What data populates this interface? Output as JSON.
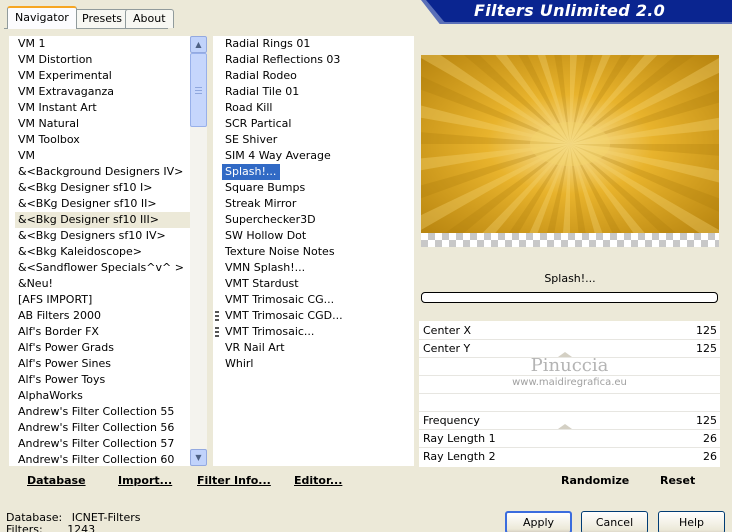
{
  "window": {
    "title": "Filters Unlimited 2.0"
  },
  "tabs": [
    {
      "label": "Navigator",
      "active": true
    },
    {
      "label": "Presets",
      "active": false
    },
    {
      "label": "About",
      "active": false
    }
  ],
  "categories": [
    "VM 1",
    "VM Distortion",
    "VM Experimental",
    "VM Extravaganza",
    "VM Instant Art",
    "VM Natural",
    "VM Toolbox",
    "VM",
    "&<Background Designers IV>",
    "&<Bkg Designer sf10 I>",
    "&<BKg Designer sf10 II>",
    "&<Bkg Designer sf10 III>",
    "&<Bkg Designers sf10 IV>",
    "&<Bkg Kaleidoscope>",
    "&<Sandflower Specials^v^ >",
    "&Neu!",
    "[AFS IMPORT]",
    "AB Filters 2000",
    "Alf's Border FX",
    "Alf's Power Grads",
    "Alf's Power Sines",
    "Alf's Power Toys",
    "AlphaWorks",
    "Andrew's Filter Collection 55",
    "Andrew's Filter Collection 56",
    "Andrew's Filter Collection 57",
    "Andrew's Filter Collection 60"
  ],
  "categories_selected_index": 11,
  "filters": [
    "Radial  Rings 01",
    "Radial Reflections 03",
    "Radial Rodeo",
    "Radial Tile 01",
    "Road Kill",
    "SCR  Partical",
    "SE Shiver",
    "SIM 4 Way Average",
    "Splash!...",
    "Square Bumps",
    "Streak Mirror",
    "Superchecker3D",
    "SW Hollow Dot",
    "Texture Noise Notes",
    "VMN Splash!...",
    "VMT Stardust",
    "VMT Trimosaic CG...",
    "VMT Trimosaic CGD...",
    "VMT Trimosaic...",
    "VR Nail Art",
    "Whirl"
  ],
  "filters_selected_index": 8,
  "filters_marked_indices": [
    17,
    18
  ],
  "current_filter": "Splash!...",
  "progress": 0,
  "params": [
    {
      "label": "Center X",
      "value": "125"
    },
    {
      "label": "Center Y",
      "value": "125"
    },
    {
      "label": "Frequency",
      "value": "125"
    },
    {
      "label": "Ray Length 1",
      "value": "26"
    },
    {
      "label": "Ray Length 2",
      "value": "26"
    }
  ],
  "watermark": {
    "line1": "Pinuccia",
    "line2": "www.maidiregrafica.eu"
  },
  "toolbar": {
    "database": "Database",
    "import": "Import...",
    "filter_info": "Filter Info...",
    "editor": "Editor...",
    "randomize": "Randomize",
    "reset": "Reset"
  },
  "buttons": {
    "apply": "Apply",
    "cancel": "Cancel",
    "help": "Help"
  },
  "status": {
    "database_label": "Database:",
    "database_value": "ICNET-Filters",
    "filters_label": "Filters:",
    "filters_value": "1243"
  },
  "colors": {
    "selection": "#316ac5",
    "banner": "#0a2590",
    "window_bg": "#ece9d8",
    "preview_gold": "#e6ab1c"
  }
}
